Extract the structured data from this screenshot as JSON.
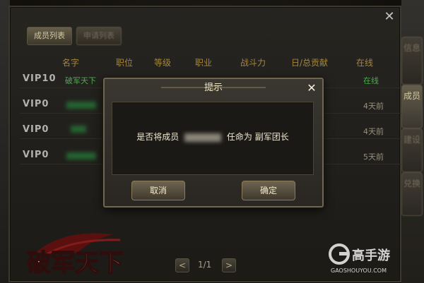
{
  "window": {
    "title": ""
  },
  "tabs": {
    "members": "成员列表",
    "applications": "申请列表"
  },
  "columns": [
    "名字",
    "职位",
    "等级",
    "职业",
    "战斗力",
    "日/总贡献",
    "在线"
  ],
  "rows": [
    {
      "vip": "VIP10",
      "name": "破军天下",
      "status": "在线"
    },
    {
      "vip": "VIP0",
      "name": "",
      "status": "4天前"
    },
    {
      "vip": "VIP0",
      "name": "",
      "status": "4天前"
    },
    {
      "vip": "VIP0",
      "name": "",
      "status": "5天前"
    }
  ],
  "side_tabs": [
    "信息",
    "成员",
    "建设",
    "兑换"
  ],
  "pager": {
    "prev": "<",
    "page": "1/1",
    "next": ">"
  },
  "dialog": {
    "title": "提示",
    "message_prefix": "是否将成员",
    "message_suffix": "任命为 副军团长",
    "cancel": "取消",
    "confirm": "确定"
  },
  "logos": {
    "game": "破军天下",
    "site_name": "高手游",
    "site_url": "GAOSHOUYOU.COM"
  },
  "colors": {
    "accent_gold": "#c9a34a",
    "online_green": "#5cd05c"
  }
}
